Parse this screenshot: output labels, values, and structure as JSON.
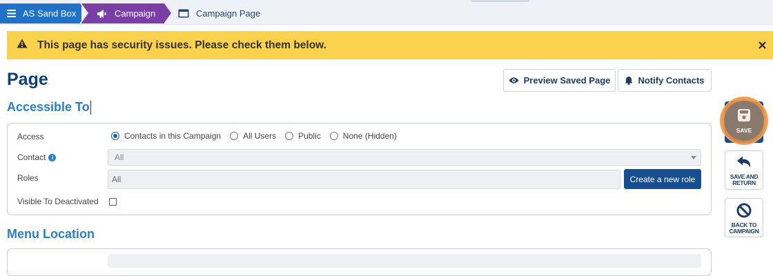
{
  "breadcrumb": {
    "home": "AS Sand Box",
    "campaign": "Campaign",
    "page": "Campaign Page"
  },
  "alert": {
    "message": "This page has security issues. Please check them below."
  },
  "header": {
    "title": "Page",
    "preview_label": "Preview Saved Page",
    "notify_label": "Notify Contacts"
  },
  "sections": {
    "accessible_to": "Accessible To",
    "menu_location": "Menu Location"
  },
  "form": {
    "access_label": "Access",
    "access_options": [
      "Contacts in this Campaign",
      "All Users",
      "Public",
      "None (Hidden)"
    ],
    "access_selected": "Contacts in this Campaign",
    "contact_label": "Contact",
    "contact_value": "All",
    "roles_label": "Roles",
    "roles_value": "All",
    "create_role_label": "Create a new role",
    "visible_deactivated_label": "Visible To Deactivated"
  },
  "actions": {
    "save": "SAVE",
    "save_and_return": [
      "SAVE AND",
      "RETURN"
    ],
    "back_to_campaign": [
      "BACK TO",
      "CAMPAIGN"
    ]
  },
  "colors": {
    "brand_blue": "#1f72c8",
    "campaign_purple": "#7a3fa6",
    "alert_yellow": "#fbd24e",
    "navy": "#174e92",
    "highlight_orange": "#ec8f40"
  }
}
